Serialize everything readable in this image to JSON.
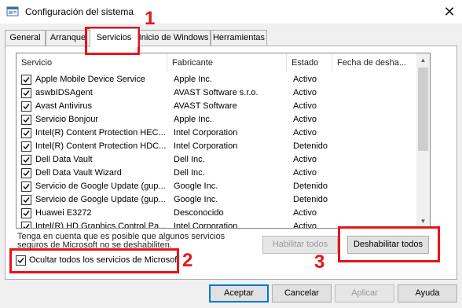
{
  "window": {
    "title": "Configuración del sistema",
    "close_glyph": "✕"
  },
  "tabs": [
    {
      "label": "General"
    },
    {
      "label": "Arranque"
    },
    {
      "label": "Servicios"
    },
    {
      "label": "Inicio de Windows"
    },
    {
      "label": "Herramientas"
    }
  ],
  "columns": {
    "service": "Servicio",
    "maker": "Fabricante",
    "state": "Estado",
    "disabled_date": "Fecha de desha..."
  },
  "services": [
    {
      "name": "Apple Mobile Device Service",
      "maker": "Apple Inc.",
      "state": "Activo",
      "checked": true
    },
    {
      "name": "aswbIDSAgent",
      "maker": "AVAST Software s.r.o.",
      "state": "Activo",
      "checked": true
    },
    {
      "name": "Avast Antivirus",
      "maker": "AVAST Software",
      "state": "Activo",
      "checked": true
    },
    {
      "name": "Servicio Bonjour",
      "maker": "Apple Inc.",
      "state": "Activo",
      "checked": true
    },
    {
      "name": "Intel(R) Content Protection HEC...",
      "maker": "Intel Corporation",
      "state": "Activo",
      "checked": true
    },
    {
      "name": "Intel(R) Content Protection HDC...",
      "maker": "Intel Corporation",
      "state": "Detenido",
      "checked": true
    },
    {
      "name": "Dell Data Vault",
      "maker": "Dell Inc.",
      "state": "Activo",
      "checked": true
    },
    {
      "name": "Dell Data Vault Wizard",
      "maker": "Dell Inc.",
      "state": "Activo",
      "checked": true
    },
    {
      "name": "Servicio de Google Update (gup...",
      "maker": "Google Inc.",
      "state": "Detenido",
      "checked": true
    },
    {
      "name": "Servicio de Google Update (gup...",
      "maker": "Google Inc.",
      "state": "Detenido",
      "checked": true
    },
    {
      "name": "Huawei E3272",
      "maker": "Desconocido",
      "state": "Activo",
      "checked": true
    },
    {
      "name": "Intel(R) HD Graphics Control Pa...",
      "maker": "Intel Corporation",
      "state": "Activo",
      "checked": true
    }
  ],
  "note": "Tenga en cuenta que es posible que algunos servicios seguros de Microsoft no se deshabiliten.",
  "hide_ms": {
    "label": "Ocultar todos los servicios de Microsoft",
    "checked": true
  },
  "buttons": {
    "enable_all": "Habilitar todos",
    "disable_all": "Deshabilitar todos",
    "ok": "Aceptar",
    "cancel": "Cancelar",
    "apply": "Aplicar",
    "help": "Ayuda"
  },
  "annotations": {
    "n1": "1",
    "n2": "2",
    "n3": "3",
    "color": "#e3161b"
  },
  "scroll": {
    "up_glyph": "▲",
    "down_glyph": "▼"
  }
}
